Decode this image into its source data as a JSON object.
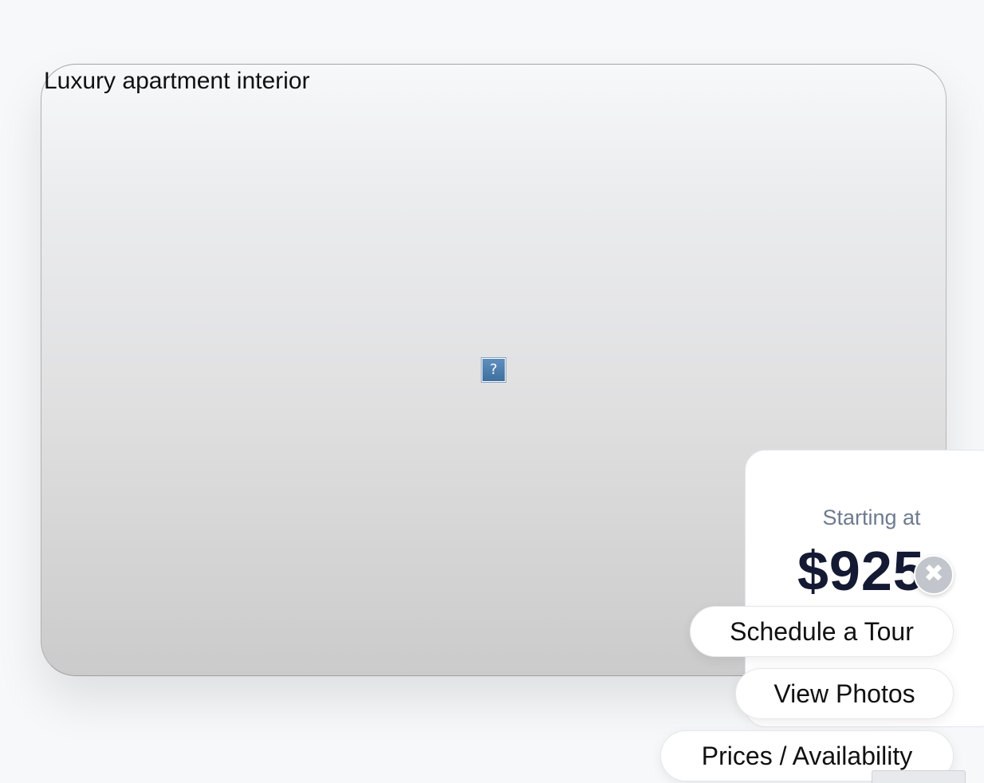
{
  "hero": {
    "image_alt": "Luxury apartment interior",
    "broken_image_glyph": "?"
  },
  "pricing": {
    "label": "Starting at",
    "amount": "$925",
    "close_glyph": "✖",
    "close_icon": "close-circle-icon"
  },
  "actions": {
    "schedule_tour": "Schedule a Tour",
    "view_photos": "View Photos",
    "prices_availability": "Prices / Availability"
  },
  "colors": {
    "price_text": "#141a33",
    "label_text": "#6e7b8f",
    "close_bg": "#c2c6cc"
  }
}
